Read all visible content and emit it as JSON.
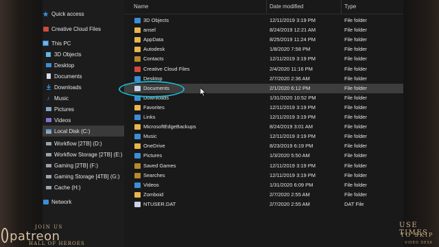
{
  "nav": {
    "items": [
      {
        "label": "Quick access",
        "icon": "star-icon"
      },
      {
        "label": "Creative Cloud Files",
        "icon": "cloud-folder-icon"
      },
      {
        "label": "This PC",
        "icon": "computer-icon"
      },
      {
        "label": "3D Objects",
        "icon": "cube-icon"
      },
      {
        "label": "Desktop",
        "icon": "desktop-icon"
      },
      {
        "label": "Documents",
        "icon": "document-icon"
      },
      {
        "label": "Downloads",
        "icon": "download-icon"
      },
      {
        "label": "Music",
        "icon": "music-icon"
      },
      {
        "label": "Pictures",
        "icon": "pictures-icon"
      },
      {
        "label": "Videos",
        "icon": "video-icon"
      },
      {
        "label": "Local Disk (C:)",
        "icon": "drive-icon"
      },
      {
        "label": "Workflow [2TB] (D:)",
        "icon": "drive-icon"
      },
      {
        "label": "Workflow Storage [2TB] (E:)",
        "icon": "drive-icon"
      },
      {
        "label": "Gaming [2TB] (F:)",
        "icon": "drive-icon"
      },
      {
        "label": "Gaming Storage [4TB] (G:)",
        "icon": "drive-icon"
      },
      {
        "label": "Cache (H:)",
        "icon": "drive-icon"
      },
      {
        "label": "Network",
        "icon": "network-icon"
      }
    ]
  },
  "columns": {
    "name": "Name",
    "date": "Date modified",
    "type": "Type"
  },
  "files": [
    {
      "name": "3D Objects",
      "date": "12/11/2019 3:19 PM",
      "type": "File folder",
      "icon": "folder-3d-icon"
    },
    {
      "name": "ansel",
      "date": "8/24/2019 12:21 AM",
      "type": "File folder",
      "icon": "folder-icon"
    },
    {
      "name": "AppData",
      "date": "8/25/2019 11:24 PM",
      "type": "File folder",
      "icon": "folder-icon"
    },
    {
      "name": "Autodesk",
      "date": "1/8/2020 7:58 PM",
      "type": "File folder",
      "icon": "folder-icon"
    },
    {
      "name": "Contacts",
      "date": "12/11/2019 3:19 PM",
      "type": "File folder",
      "icon": "contacts-icon"
    },
    {
      "name": "Creative Cloud Files",
      "date": "2/4/2020 11:16 PM",
      "type": "File folder",
      "icon": "cloud-folder-icon"
    },
    {
      "name": "Desktop",
      "date": "2/7/2020 2:36 AM",
      "type": "File folder",
      "icon": "desktop-icon"
    },
    {
      "name": "Documents",
      "date": "2/1/2020 6:12 PM",
      "type": "File folder",
      "icon": "document-icon"
    },
    {
      "name": "Downloads",
      "date": "1/31/2020 10:52 PM",
      "type": "File folder",
      "icon": "download-icon"
    },
    {
      "name": "Favorites",
      "date": "12/11/2019 3:19 PM",
      "type": "File folder",
      "icon": "favorites-icon"
    },
    {
      "name": "Links",
      "date": "12/11/2019 3:19 PM",
      "type": "File folder",
      "icon": "links-icon"
    },
    {
      "name": "MicrosoftEdgeBackups",
      "date": "8/24/2019 3:01 AM",
      "type": "File folder",
      "icon": "folder-icon"
    },
    {
      "name": "Music",
      "date": "12/11/2019 3:19 PM",
      "type": "File folder",
      "icon": "music-icon"
    },
    {
      "name": "OneDrive",
      "date": "8/23/2019 6:19 PM",
      "type": "File folder",
      "icon": "folder-icon"
    },
    {
      "name": "Pictures",
      "date": "1/3/2020 5:50 AM",
      "type": "File folder",
      "icon": "pictures-icon"
    },
    {
      "name": "Saved Games",
      "date": "12/11/2019 3:19 PM",
      "type": "File folder",
      "icon": "saved-games-icon"
    },
    {
      "name": "Searches",
      "date": "12/11/2019 3:19 PM",
      "type": "File folder",
      "icon": "search-icon"
    },
    {
      "name": "Videos",
      "date": "1/31/2020 6:09 PM",
      "type": "File folder",
      "icon": "video-icon"
    },
    {
      "name": "Zomboid",
      "date": "2/7/2020 2:55 AM",
      "type": "File folder",
      "icon": "folder-icon"
    },
    {
      "name": "NTUSER.DAT",
      "date": "2/7/2020 2:55 AM",
      "type": "DAT File",
      "icon": "file-icon"
    }
  ],
  "overlay": {
    "patreon_join": "JOIN US",
    "patreon_logo": "patreon",
    "patreon_hall": "HALL OF HEROES",
    "brand_line1": "USE TIMES",
    "brand_line2": "TO SKIP",
    "brand_line3": "VIDEO DESK"
  },
  "colors": {
    "accent_annotation": "#1fb3c9",
    "folder": "#e8b64a",
    "selection": "#3d3d3d"
  }
}
